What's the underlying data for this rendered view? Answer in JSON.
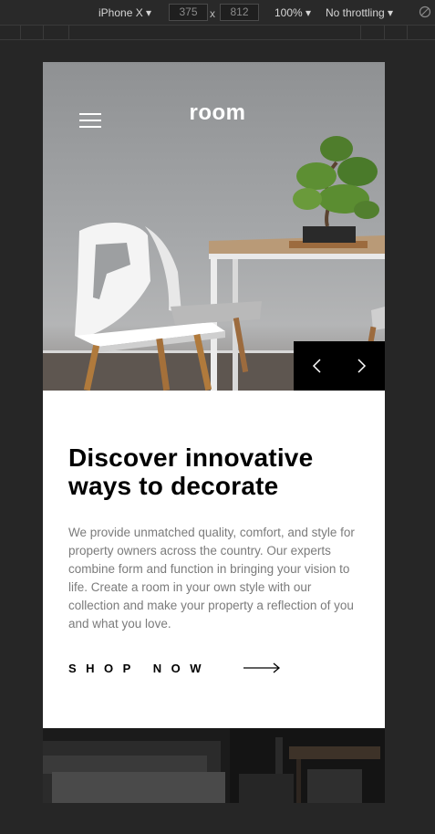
{
  "devtools": {
    "device": "iPhone X",
    "width": "375",
    "height": "812",
    "times": "x",
    "zoom": "100%",
    "throttling": "No throttling"
  },
  "page": {
    "logo": "room",
    "headline_line1": "Discover innovative",
    "headline_line2": "ways to decorate",
    "description": "We provide unmatched quality, comfort, and style for property owners across the country. Our experts combine form and function in bringing your vision to life. Create a room in your own style with our collection and make your property a reflection of you and what you love.",
    "cta": "SHOP NOW"
  },
  "icons": {
    "menu": "hamburger-icon",
    "prev": "angle-left-icon",
    "next": "angle-right-icon",
    "cta_arrow": "long-arrow-right-icon",
    "rotate": "rotate-icon"
  }
}
